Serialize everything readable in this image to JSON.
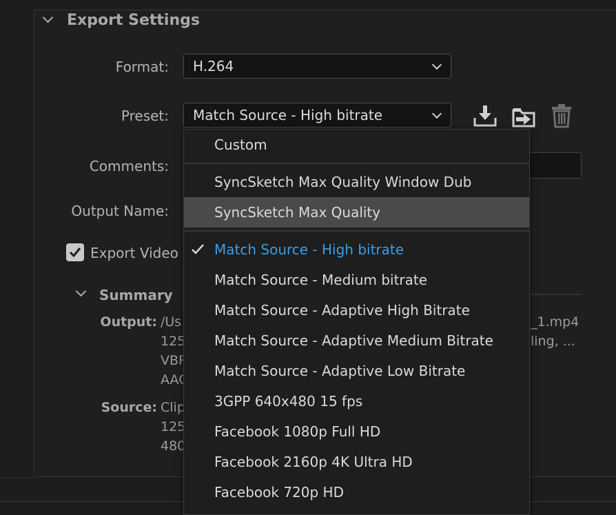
{
  "export_settings": {
    "title": "Export Settings",
    "format_label": "Format:",
    "format_value": "H.264",
    "preset_label": "Preset:",
    "preset_value": "Match Source - High bitrate",
    "comments_label": "Comments:",
    "output_name_label": "Output Name:",
    "export_video_label": "Export Video",
    "export_video_checked": true
  },
  "summary": {
    "title": "Summary",
    "output_label": "Output:",
    "output_lines": [
      "/Us",
      "125",
      "VBR",
      "AAC"
    ],
    "output_right_1": "_1.mp4",
    "output_right_2": "ling, ...",
    "source_label": "Source:",
    "source_lines": [
      "Clip",
      "125",
      "480"
    ]
  },
  "preset_icons": [
    "save-preset-icon",
    "import-preset-icon",
    "delete-preset-icon"
  ],
  "preset_menu": {
    "items": [
      {
        "label": "Custom"
      },
      {
        "label": "SyncSketch Max Quality Window Dub"
      },
      {
        "label": "SyncSketch Max Quality",
        "hover": true
      },
      {
        "label": "Match Source - High bitrate",
        "selected": true
      },
      {
        "label": "Match Source - Medium bitrate"
      },
      {
        "label": "Match Source - Adaptive High Bitrate"
      },
      {
        "label": "Match Source - Adaptive Medium Bitrate"
      },
      {
        "label": "Match Source - Adaptive Low Bitrate"
      },
      {
        "label": "3GPP 640x480 15 fps"
      },
      {
        "label": "Facebook 1080p Full HD"
      },
      {
        "label": "Facebook 2160p 4K Ultra HD"
      },
      {
        "label": "Facebook 720p HD"
      }
    ]
  },
  "colors": {
    "selected_text": "#3a9ee8",
    "hover_bg": "#4a4a4a",
    "background": "#1d1d1d"
  }
}
